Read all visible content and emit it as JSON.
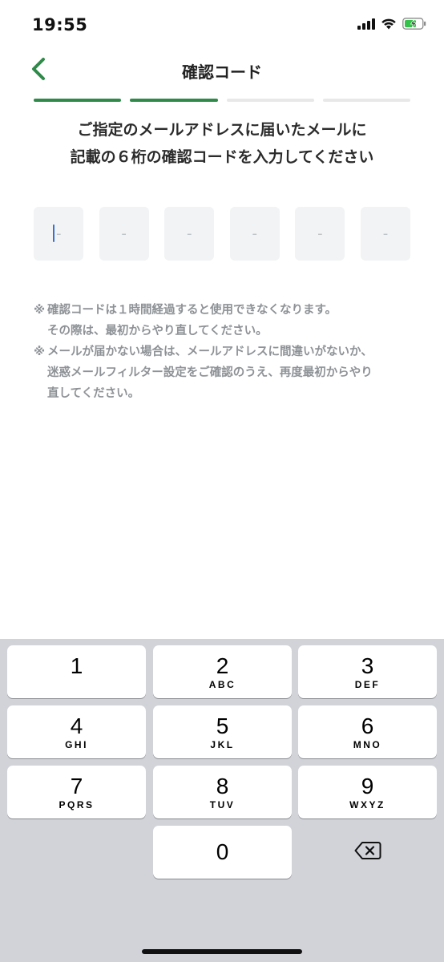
{
  "status_bar": {
    "time": "19:55",
    "icons": [
      "cellular-signal-icon",
      "wifi-icon",
      "battery-charging-icon"
    ]
  },
  "header": {
    "title": "確認コード",
    "back_icon": "chevron-left-icon"
  },
  "progress": {
    "total_steps": 4,
    "completed_steps": 2,
    "active_color": "#2f8a4a"
  },
  "instruction": {
    "line1": "ご指定のメールアドレスに届いたメールに",
    "line2": "記載の６桁の確認コードを入力してください"
  },
  "code_input": {
    "digits": [
      "-",
      "-",
      "-",
      "-",
      "-",
      "-"
    ],
    "focused_index": 0
  },
  "notes": [
    {
      "mark": "※",
      "lines": [
        "確認コードは１時間経過すると使用できなくなります。",
        "その際は、最初からやり直してください。"
      ]
    },
    {
      "mark": "※",
      "lines": [
        "メールが届かない場合は、メールアドレスに間違いがないか、",
        "迷惑メールフィルター設定をご確認のうえ、再度最初からやり",
        "直してください。"
      ]
    }
  ],
  "keypad": {
    "keys": [
      {
        "digit": "1",
        "letters": ""
      },
      {
        "digit": "2",
        "letters": "ABC"
      },
      {
        "digit": "3",
        "letters": "DEF"
      },
      {
        "digit": "4",
        "letters": "GHI"
      },
      {
        "digit": "5",
        "letters": "JKL"
      },
      {
        "digit": "6",
        "letters": "MNO"
      },
      {
        "digit": "7",
        "letters": "PQRS"
      },
      {
        "digit": "8",
        "letters": "TUV"
      },
      {
        "digit": "9",
        "letters": "WXYZ"
      },
      {
        "digit": "0",
        "letters": ""
      }
    ],
    "delete_icon": "backspace-icon"
  }
}
